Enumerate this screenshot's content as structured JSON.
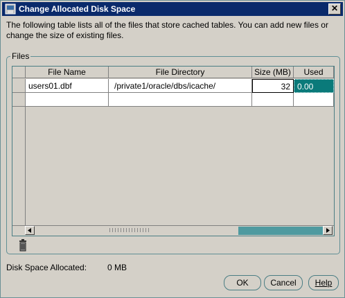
{
  "window": {
    "title": "Change Allocated Disk Space",
    "close_glyph": "✕"
  },
  "description": "The following table lists all of the files that store cached tables.  You can add new files or change the size of existing files.",
  "files_group": {
    "label": "Files"
  },
  "table": {
    "columns": [
      "File Name",
      "File Directory",
      "Size (MB)",
      "Used"
    ],
    "rows": [
      {
        "file_name": "users01.dbf",
        "directory": "/private1/oracle/dbs/icache/",
        "size": "32",
        "used": "0.00"
      },
      {
        "file_name": "",
        "directory": "",
        "size": "",
        "used": ""
      }
    ]
  },
  "icons": {
    "delete": "trash-icon",
    "app": "disk-space-icon",
    "scroll_left": "arrow-left-icon",
    "scroll_right": "arrow-right-icon"
  },
  "status": {
    "label": "Disk Space Allocated:",
    "value": "0 MB"
  },
  "buttons": {
    "ok": "OK",
    "cancel": "Cancel",
    "help": "Help"
  },
  "colors": {
    "title_bar": "#0a2a6b",
    "accent": "#0a7a7a",
    "scroll_thumb": "#4f9aa0",
    "background": "#d4d0c8"
  }
}
